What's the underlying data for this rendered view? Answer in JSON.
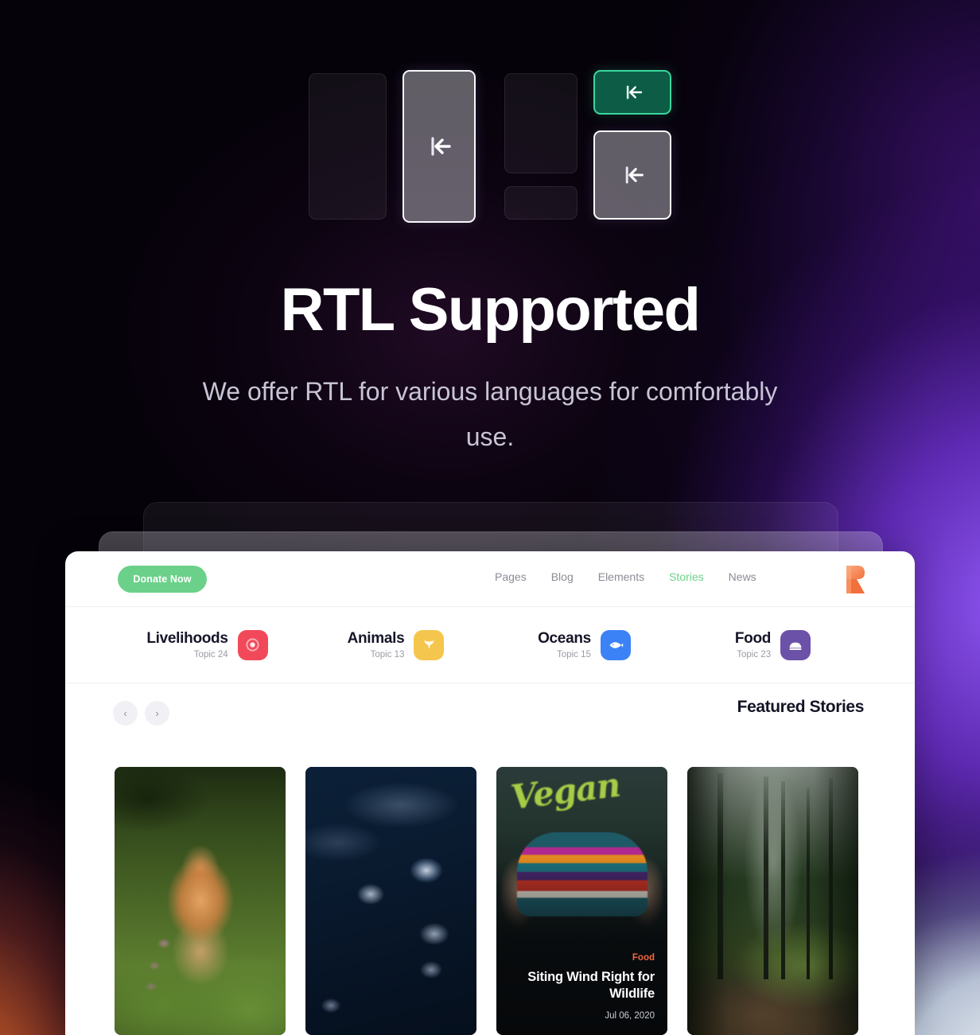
{
  "hero": {
    "heading": "RTL Supported",
    "subheading": "We offer RTL for various languages for comfortably use."
  },
  "illustration": {
    "blocks": [
      {
        "name": "block-plain-left",
        "style": "dim",
        "icon": ""
      },
      {
        "name": "block-rtl-tall",
        "style": "light",
        "icon": "rtl-arrow-icon"
      },
      {
        "name": "block-plain-top",
        "style": "dim",
        "icon": ""
      },
      {
        "name": "block-plain-short",
        "style": "dim",
        "icon": ""
      },
      {
        "name": "block-rtl-green",
        "style": "green",
        "icon": "rtl-arrow-icon"
      },
      {
        "name": "block-rtl-light",
        "style": "light",
        "icon": "rtl-arrow-icon"
      }
    ],
    "accent_green": "#3bd79c",
    "accent_green_fill": "#0c5c46"
  },
  "site": {
    "navbar": {
      "donate_label": "Donate Now",
      "donate_color": "#6bd18a",
      "links": [
        {
          "label": "Pages",
          "active": false
        },
        {
          "label": "Blog",
          "active": false
        },
        {
          "label": "Elements",
          "active": false
        },
        {
          "label": "Stories",
          "active": true
        },
        {
          "label": "News",
          "active": false
        }
      ],
      "logo_name": "brand-logo-r",
      "logo_color": "#f4854f"
    },
    "categories": [
      {
        "title": "Livelihoods",
        "topic": "Topic 24",
        "color": "#f2495a",
        "icon": "lifebuoy-icon"
      },
      {
        "title": "Animals",
        "topic": "Topic 13",
        "color": "#f5c64e",
        "icon": "bull-head-icon"
      },
      {
        "title": "Oceans",
        "topic": "Topic 15",
        "color": "#3b82f6",
        "icon": "fish-icon"
      },
      {
        "title": "Food",
        "topic": "Topic 23",
        "color": "#6b51a8",
        "icon": "food-cover-icon"
      }
    ],
    "featured": {
      "title": "Featured Stories",
      "prev_label": "‹",
      "next_label": "›"
    },
    "stories": [
      {
        "image": "fox-photo",
        "category": "",
        "title": "",
        "date": "",
        "has_overlay": false
      },
      {
        "image": "jellyfish-photo",
        "category": "",
        "title": "",
        "date": "",
        "has_overlay": false
      },
      {
        "image": "vegan-burger-photo",
        "image_text": "Vegan",
        "category": "Food",
        "title": "Siting Wind Right for Wildlife",
        "date": "Jul 06, 2020",
        "has_overlay": true
      },
      {
        "image": "forest-photo",
        "category": "",
        "title": "",
        "date": "",
        "has_overlay": false
      }
    ]
  },
  "colors": {
    "page_background_dark": "#06020a",
    "glow_purple": "#6c30cd",
    "glow_orange": "#c45e2a",
    "glow_lightblue": "#eef4f8",
    "story_category_orange": "#f2663f"
  }
}
